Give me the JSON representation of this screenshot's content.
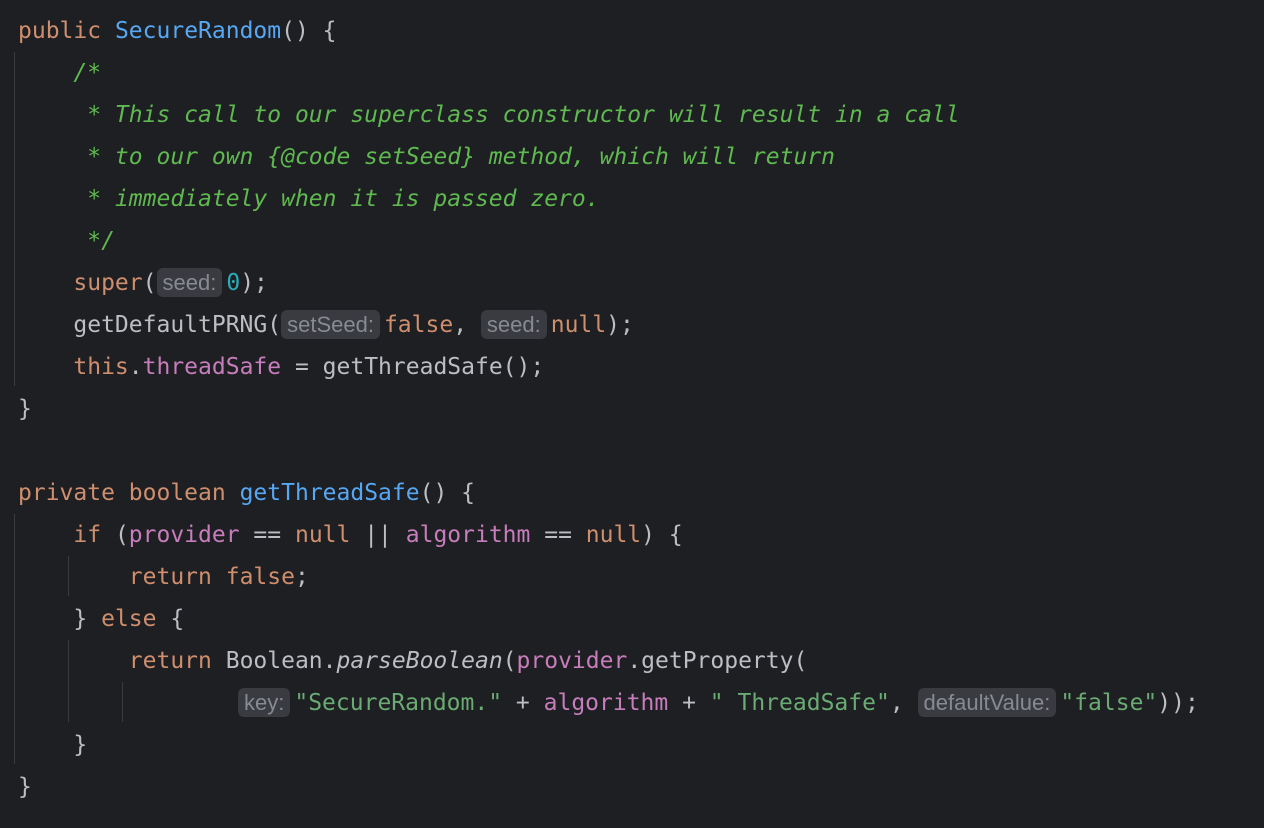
{
  "colors": {
    "background": "#1e1f22",
    "keyword": "#cf8e6d",
    "function": "#56a8f5",
    "comment": "#5fb950",
    "number": "#2aacb8",
    "field": "#c77dbb",
    "string": "#6aab73",
    "default_text": "#bcbec4",
    "hint_bg": "#393b40"
  },
  "code": {
    "l1": {
      "kw": "public",
      "name": "SecureRandom",
      "rest": "() {"
    },
    "l2": {
      "comment": "/*"
    },
    "l3": {
      "comment": " * This call to our superclass constructor will result in a call"
    },
    "l4": {
      "comment": " * to our own {@code setSeed} method, which will return"
    },
    "l5": {
      "comment": " * immediately when it is passed zero."
    },
    "l6": {
      "comment": " */"
    },
    "l7": {
      "kw": "super",
      "p1": "(",
      "hint_seed": "seed:",
      "num": "0",
      "p2": ");"
    },
    "l8": {
      "fn": "getDefaultPRNG(",
      "hint_setseed": "setSeed:",
      "kw_false": "false",
      "comma": ", ",
      "hint_seed": "seed:",
      "kw_null": "null",
      "end": ");"
    },
    "l9": {
      "kw_this": "this",
      "dot": ".",
      "field": "threadSafe",
      "rest": " = getThreadSafe();"
    },
    "l10": {
      "brace": "}"
    },
    "l12": {
      "kw": "private boolean",
      "sp": " ",
      "name": "getThreadSafe",
      "rest": "() {"
    },
    "l13": {
      "kw_if": "if",
      "p1": " (",
      "f1": "provider",
      "op1": " == ",
      "n1": "null",
      "op2": " || ",
      "f2": "algorithm",
      "op3": " == ",
      "n2": "null",
      "end": ") {"
    },
    "l14": {
      "kw_return": "return",
      "sp": " ",
      "kw_false": "false",
      "semi": ";"
    },
    "l15": {
      "b1": "} ",
      "kw_else": "else",
      "b2": " {"
    },
    "l16": {
      "kw_return": "return",
      "sp": " Boolean.",
      "method": "parseBoolean",
      "p1": "(",
      "field": "provider",
      "rest": ".getProperty("
    },
    "l17": {
      "hint_key": "key:",
      "s1": "\"SecureRandom.\"",
      "plus1": " + ",
      "field": "algorithm",
      "plus2": " + ",
      "s2": "\" ThreadSafe\"",
      "comma": ", ",
      "hint_default": "defaultValue:",
      "s3": "\"false\"",
      "end": "));"
    },
    "l18": {
      "brace": "}"
    },
    "l19": {
      "brace": "}"
    }
  }
}
